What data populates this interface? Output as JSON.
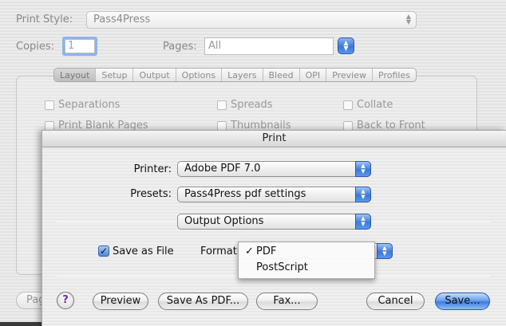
{
  "background_dialog": {
    "print_style_label": "Print Style:",
    "print_style_value": "Pass4Press",
    "copies_label": "Copies:",
    "copies_value": "1",
    "pages_label": "Pages:",
    "pages_value": "All",
    "tabs": [
      "Layout",
      "Setup",
      "Output",
      "Options",
      "Layers",
      "Bleed",
      "OPI",
      "Preview",
      "Profiles"
    ],
    "selected_tab": "Layout",
    "checkboxes": [
      {
        "label": "Separations",
        "checked": false
      },
      {
        "label": "Spreads",
        "checked": false
      },
      {
        "label": "Collate",
        "checked": false
      },
      {
        "label": "Print Blank Pages",
        "checked": false
      },
      {
        "label": "Thumbnails",
        "checked": false
      },
      {
        "label": "Back to Front",
        "checked": false
      }
    ],
    "partial_button_label": "Pag"
  },
  "print_sheet": {
    "title": "Print",
    "printer_label": "Printer:",
    "printer_value": "Adobe PDF 7.0",
    "presets_label": "Presets:",
    "presets_value": "Pass4Press pdf settings",
    "panel_value": "Output Options",
    "save_as_file_label": "Save as File",
    "save_as_file_checked": true,
    "format_label": "Format",
    "format_menu": {
      "options": [
        "PDF",
        "PostScript"
      ],
      "selected": "PDF",
      "check_glyph": "✓"
    },
    "help_label": "?",
    "buttons": {
      "preview": "Preview",
      "save_as_pdf": "Save As PDF...",
      "fax": "Fax...",
      "cancel": "Cancel",
      "save": "Save..."
    }
  },
  "colors": {
    "accent_blue": "#3e7ddd",
    "help_purple": "#6b2fa0"
  }
}
